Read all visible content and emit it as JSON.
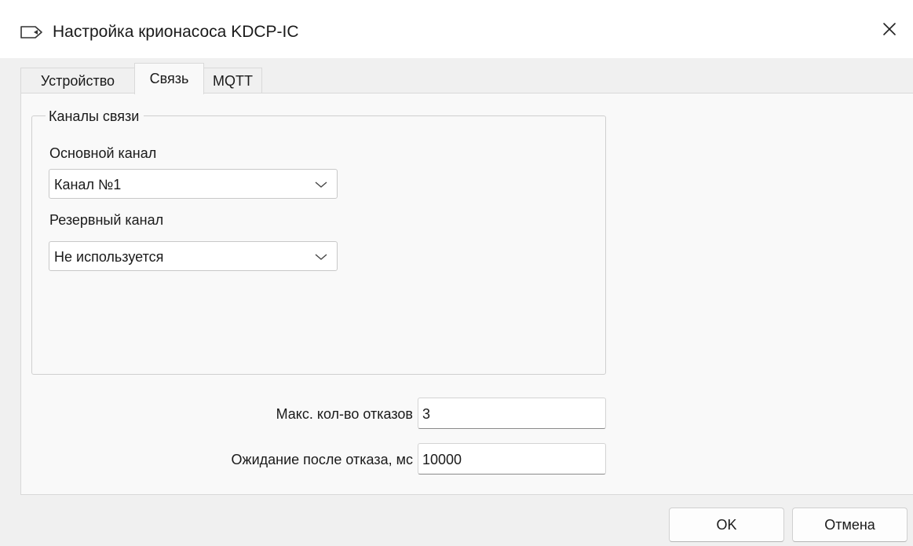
{
  "window": {
    "title": "Настройка крионасоса KDCP-IC",
    "title_icon": "tag-icon",
    "close_icon": "close-icon"
  },
  "tabs": [
    {
      "label": "Устройство",
      "active": false
    },
    {
      "label": "Связь",
      "active": true
    },
    {
      "label": "MQTT",
      "active": false
    }
  ],
  "channels": {
    "group_title": "Каналы связи",
    "primary_label": "Основной канал",
    "primary_value": "Канал №1",
    "backup_label": "Резервный канал",
    "backup_value": "Не используется"
  },
  "settings": {
    "max_failures_label": "Макс. кол-во отказов",
    "max_failures_value": "3",
    "wait_after_failure_label": "Ожидание после отказа, мс",
    "wait_after_failure_value": "10000"
  },
  "buttons": {
    "ok": "OK",
    "cancel": "Отмена"
  }
}
